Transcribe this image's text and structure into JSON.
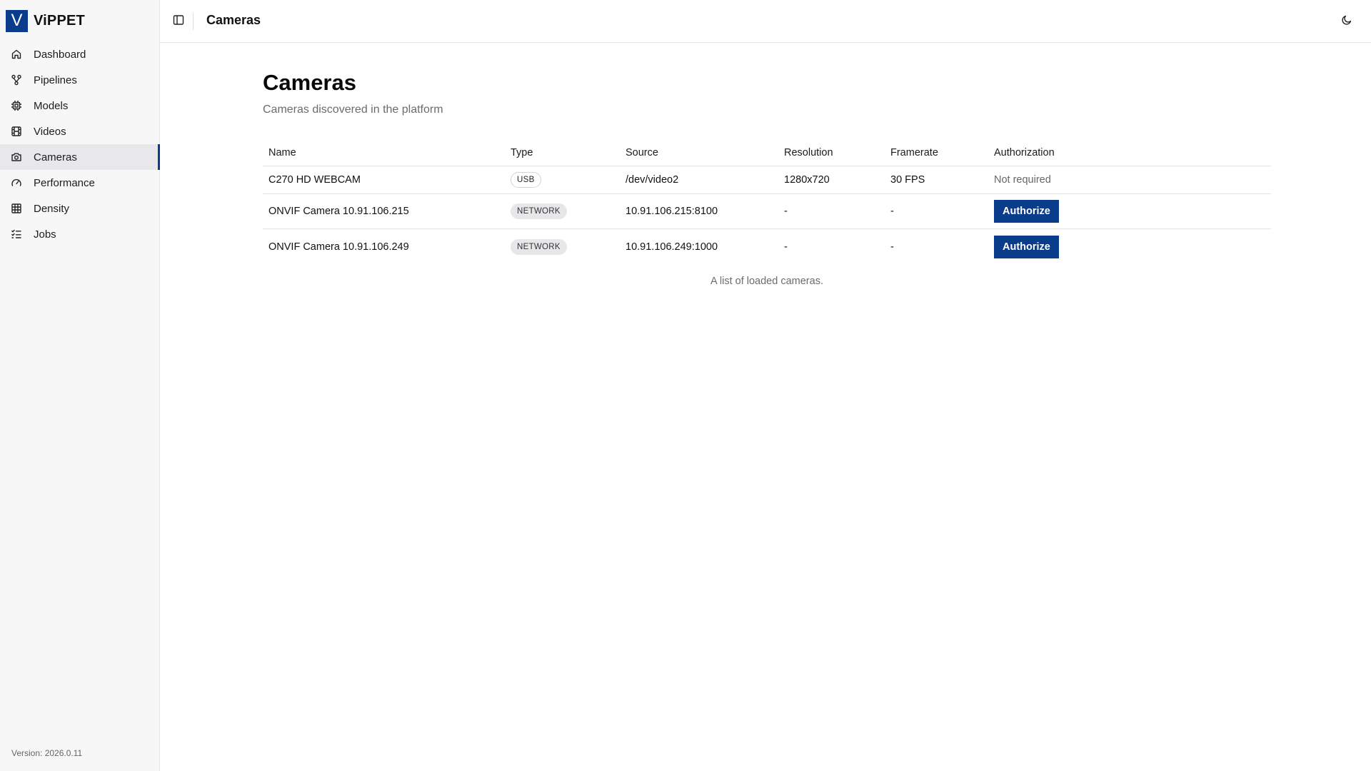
{
  "app": {
    "logo_letter": "V",
    "name": "ViPPET",
    "version": "Version: 2026.0.11",
    "accent_color": "#0a3c8c"
  },
  "sidebar": {
    "items": [
      {
        "label": "Dashboard",
        "icon": "home-icon",
        "active": false
      },
      {
        "label": "Pipelines",
        "icon": "pipeline-icon",
        "active": false
      },
      {
        "label": "Models",
        "icon": "chip-icon",
        "active": false
      },
      {
        "label": "Videos",
        "icon": "film-icon",
        "active": false
      },
      {
        "label": "Cameras",
        "icon": "camera-icon",
        "active": true
      },
      {
        "label": "Performance",
        "icon": "gauge-icon",
        "active": false
      },
      {
        "label": "Density",
        "icon": "grid-icon",
        "active": false
      },
      {
        "label": "Jobs",
        "icon": "list-checks-icon",
        "active": false
      }
    ]
  },
  "header": {
    "title": "Cameras",
    "toggle_icon": "sidebar-toggle-icon",
    "theme_icon": "moon-icon"
  },
  "main": {
    "title": "Cameras",
    "subtitle": "Cameras discovered in the platform",
    "table": {
      "columns": [
        "Name",
        "Type",
        "Source",
        "Resolution",
        "Framerate",
        "Authorization"
      ],
      "rows": [
        {
          "name": "C270 HD WEBCAM",
          "type": "USB",
          "source": "/dev/video2",
          "resolution": "1280x720",
          "framerate": "30 FPS",
          "authorization": "Not required"
        },
        {
          "name": "ONVIF Camera 10.91.106.215",
          "type": "NETWORK",
          "source": "10.91.106.215:8100",
          "resolution": "-",
          "framerate": "-",
          "authorization": "Authorize"
        },
        {
          "name": "ONVIF Camera 10.91.106.249",
          "type": "NETWORK",
          "source": "10.91.106.249:1000",
          "resolution": "-",
          "framerate": "-",
          "authorization": "Authorize"
        }
      ],
      "caption": "A list of loaded cameras."
    }
  }
}
